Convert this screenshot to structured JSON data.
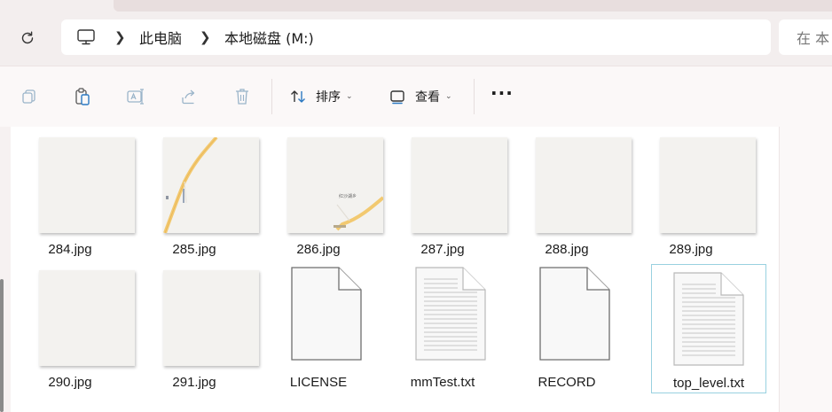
{
  "breadcrumb": {
    "items": [
      "此电脑",
      "本地磁盘 (M:)"
    ]
  },
  "search": {
    "placeholder": "在 本"
  },
  "commandbar": {
    "sort_label": "排序",
    "view_label": "查看"
  },
  "files": [
    {
      "name": "284.jpg",
      "kind": "image-blank"
    },
    {
      "name": "285.jpg",
      "kind": "image-map-road"
    },
    {
      "name": "286.jpg",
      "kind": "image-map-label",
      "map_label": "红沙湖乡"
    },
    {
      "name": "287.jpg",
      "kind": "image-blank"
    },
    {
      "name": "288.jpg",
      "kind": "image-blank"
    },
    {
      "name": "289.jpg",
      "kind": "image-blank"
    },
    {
      "name": "290.jpg",
      "kind": "image-blank"
    },
    {
      "name": "291.jpg",
      "kind": "image-blank"
    },
    {
      "name": "LICENSE",
      "kind": "document-blank"
    },
    {
      "name": "mmTest.txt",
      "kind": "document-text"
    },
    {
      "name": "RECORD",
      "kind": "document-blank"
    },
    {
      "name": "top_level.txt",
      "kind": "document-text",
      "selected": true
    }
  ],
  "colors": {
    "accent_selection": "#99d1e0",
    "map_road": "#f2c970",
    "page_background": "#f3eeee"
  }
}
